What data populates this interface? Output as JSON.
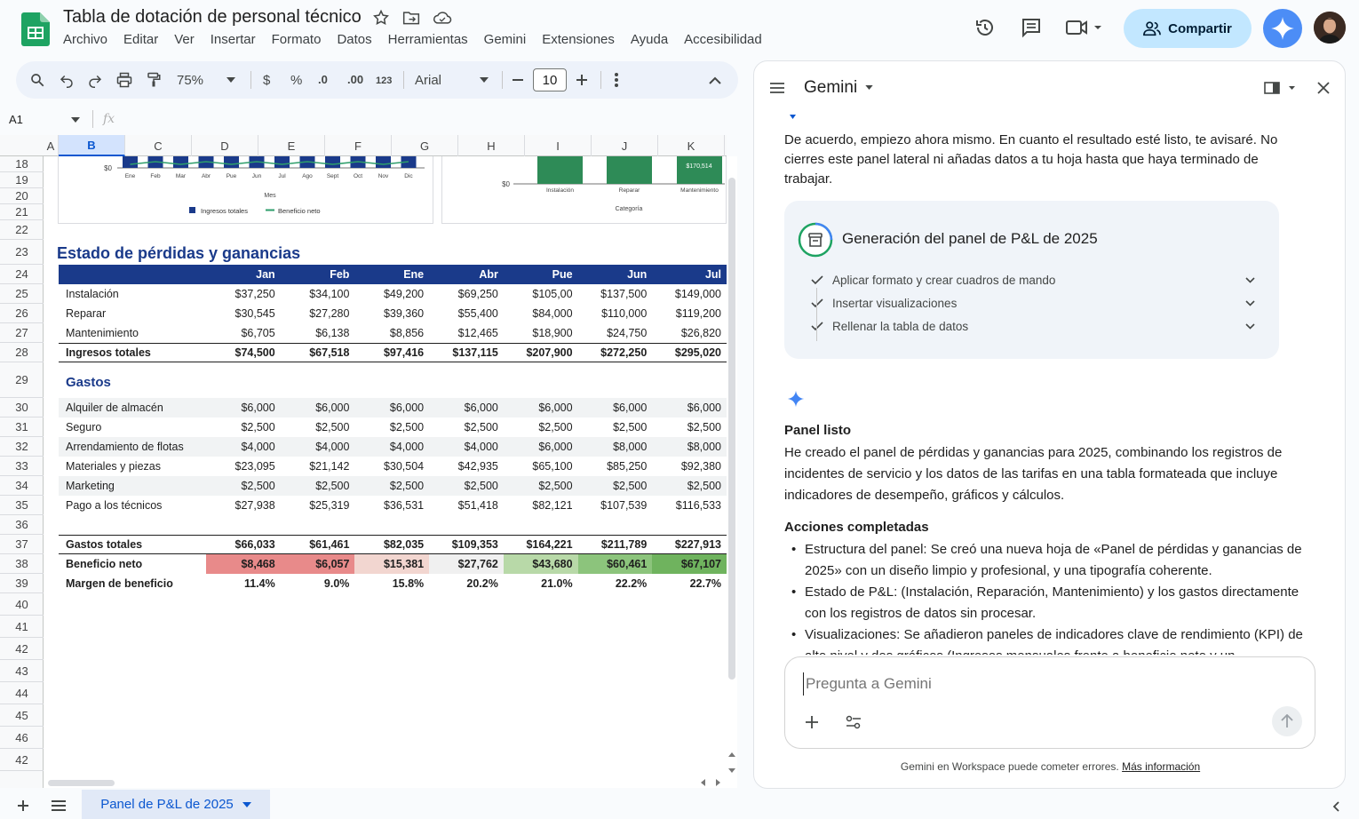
{
  "app": {
    "title": "Tabla de dotación de personal técnico",
    "menu": [
      "Archivo",
      "Editar",
      "Ver",
      "Insertar",
      "Formato",
      "Datos",
      "Herramientas",
      "Gemini",
      "Extensiones",
      "Ayuda",
      "Accesibilidad"
    ],
    "share_label": "Compartir"
  },
  "toolbar": {
    "zoom": "75%",
    "currency": "$",
    "percent": "%",
    "dec_minus": ".0",
    "dec_plus": ".00",
    "num_format": "123",
    "font": "Arial",
    "font_size": "10"
  },
  "formula_bar": {
    "cell_ref": "A1",
    "fx": "fx"
  },
  "columns": [
    "A",
    "B",
    "C",
    "D",
    "E",
    "F",
    "G",
    "H",
    "I",
    "J",
    "K"
  ],
  "rows": [
    "18",
    "19",
    "20",
    "21",
    "22",
    "23",
    "24",
    "25",
    "26",
    "27",
    "28",
    "29",
    "30",
    "31",
    "32",
    "33",
    "34",
    "35",
    "36",
    "37",
    "38",
    "39",
    "40",
    "41",
    "42",
    "43",
    "44",
    "45",
    "46",
    "42"
  ],
  "chart_left": {
    "ylabel_tick": "$0",
    "months": [
      "Ene",
      "Feb",
      "Mar",
      "Abr",
      "Pue",
      "Jun",
      "Jul",
      "Ago",
      "Sept",
      "Oct",
      "Nov",
      "Dic"
    ],
    "xlabel": "Mes",
    "legend": [
      "Ingresos totales",
      "Beneficio neto"
    ],
    "colors": {
      "bar": "#1a3a8a",
      "line": "#2e9e6b"
    }
  },
  "chart_right": {
    "ylabel_tick": "$0",
    "categories": [
      "Instalación",
      "Reparar",
      "Mantenimiento"
    ],
    "data_label": "$170,514",
    "xlabel": "Categoría",
    "color": "#2e8b57"
  },
  "pl": {
    "title": "Estado de pérdidas y ganancias",
    "months": [
      "Jan",
      "Feb",
      "Ene",
      "Abr",
      "Pue",
      "Jun",
      "Jul"
    ],
    "revenue": [
      {
        "label": "Instalación",
        "values": [
          "$37,250",
          "$34,100",
          "$49,200",
          "$69,250",
          "$105,00",
          "$137,500",
          "$149,000"
        ]
      },
      {
        "label": "Reparar",
        "values": [
          "$30,545",
          "$27,280",
          "$39,360",
          "$55,400",
          "$84,000",
          "$110,000",
          "$119,200"
        ]
      },
      {
        "label": "Mantenimiento",
        "values": [
          "$6,705",
          "$6,138",
          "$8,856",
          "$12,465",
          "$18,900",
          "$24,750",
          "$26,820"
        ]
      }
    ],
    "total_revenue": {
      "label": "Ingresos totales",
      "values": [
        "$74,500",
        "$67,518",
        "$97,416",
        "$137,115",
        "$207,900",
        "$272,250",
        "$295,020"
      ]
    },
    "expenses_title": "Gastos",
    "expenses": [
      {
        "label": "Alquiler de almacén",
        "values": [
          "$6,000",
          "$6,000",
          "$6,000",
          "$6,000",
          "$6,000",
          "$6,000",
          "$6,000"
        ]
      },
      {
        "label": "Seguro",
        "values": [
          "$2,500",
          "$2,500",
          "$2,500",
          "$2,500",
          "$2,500",
          "$2,500",
          "$2,500"
        ]
      },
      {
        "label": "Arrendamiento de flotas",
        "values": [
          "$4,000",
          "$4,000",
          "$4,000",
          "$4,000",
          "$6,000",
          "$8,000",
          "$8,000"
        ]
      },
      {
        "label": "Materiales y piezas",
        "values": [
          "$23,095",
          "$21,142",
          "$30,504",
          "$42,935",
          "$65,100",
          "$85,250",
          "$92,380"
        ]
      },
      {
        "label": "Marketing",
        "values": [
          "$2,500",
          "$2,500",
          "$2,500",
          "$2,500",
          "$2,500",
          "$2,500",
          "$2,500"
        ]
      },
      {
        "label": "Pago a los técnicos",
        "values": [
          "$27,938",
          "$25,319",
          "$36,531",
          "$51,418",
          "$82,121",
          "$107,539",
          "$116,533"
        ]
      }
    ],
    "total_expenses": {
      "label": "Gastos totales",
      "values": [
        "$66,033",
        "$61,461",
        "$82,035",
        "$109,353",
        "$164,221",
        "$211,789",
        "$227,913"
      ]
    },
    "net_profit": {
      "label": "Beneficio neto",
      "values": [
        "$8,468",
        "$6,057",
        "$15,381",
        "$27,762",
        "$43,680",
        "$60,461",
        "$67,107"
      ],
      "colors": [
        "#e88a8a",
        "#e88a8a",
        "#f2d6d0",
        "#f0f0f0",
        "#b8d9a8",
        "#8cc47c",
        "#6fb35e"
      ]
    },
    "margin": {
      "label": "Margen de beneficio",
      "values": [
        "11.4%",
        "9.0%",
        "15.8%",
        "20.2%",
        "21.0%",
        "22.2%",
        "22.7%"
      ]
    }
  },
  "sheet": {
    "tab_label": "Panel de P&L de 2025"
  },
  "gemini": {
    "title": "Gemini",
    "intro": "De acuerdo, empiezo ahora mismo. En cuanto el resultado esté listo, te avisaré. No cierres este panel lateral ni añadas datos a tu hoja hasta que haya terminado de trabajar.",
    "card_title": "Generación del panel de P&L de 2025",
    "steps": [
      "Aplicar formato y crear cuadros de mando",
      "Insertar visualizaciones",
      "Rellenar la tabla de datos"
    ],
    "ready_title": "Panel listo",
    "ready_text": "He creado el panel de pérdidas y ganancias para 2025, combinando los registros de incidentes de servicio y los datos de las tarifas en una tabla formateada que incluye indicadores de desempeño, gráficos y cálculos.",
    "actions_title": "Acciones completadas",
    "actions": [
      "Estructura del panel: Se creó una nueva hoja de «Panel de pérdidas y ganancias de 2025» con un diseño limpio y profesional, y una tipografía coherente.",
      "Estado de P&L: (Instalación, Reparación, Mantenimiento) y los gastos directamente con los registros de datos sin procesar.",
      "Visualizaciones: Se añadieron paneles de indicadores clave de rendimiento (KPI) de alto nivel y dos gráficos (Ingresos mensuales frente a beneficio neto y un"
    ],
    "input_placeholder": "Pregunta a Gemini",
    "footer": "Gemini en Workspace puede cometer errores.",
    "footer_link": "Más información"
  }
}
